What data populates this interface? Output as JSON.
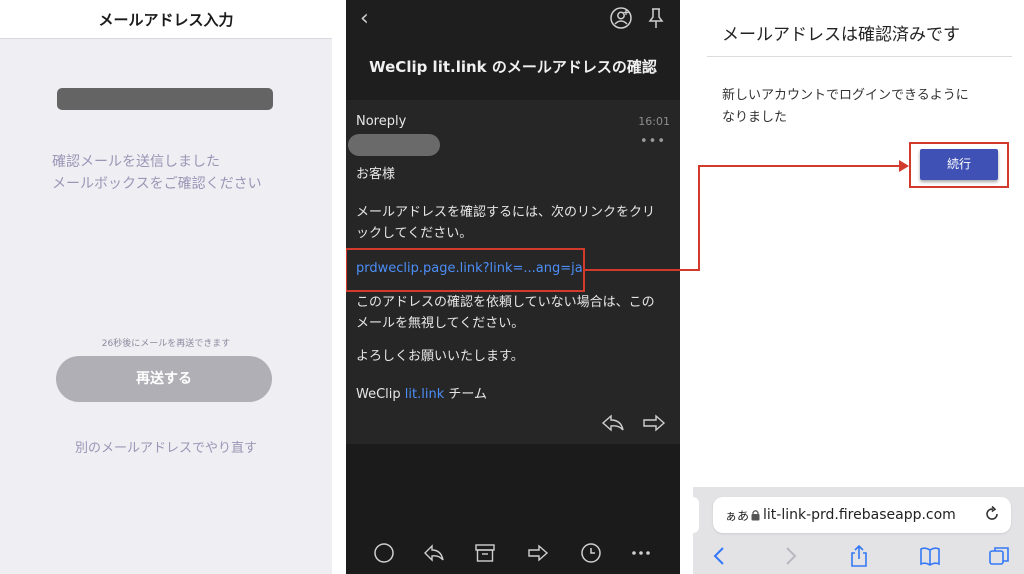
{
  "left": {
    "header_title": "メールアドレス入力",
    "sent_line1": "確認メールを送信しました",
    "sent_line2": "メールボックスをご確認ください",
    "countdown": "26秒後にメールを再送できます",
    "resend_label": "再送する",
    "retry_link": "別のメールアドレスでやり直す"
  },
  "middle": {
    "subject": "WeClip lit.link のメールアドレスの確認",
    "sender": "Noreply",
    "time": "16:01",
    "greeting": "お客様",
    "para1_line1": "メールアドレスを確認するには、次のリンクをクリ",
    "para1_line2": "ックしてください。",
    "link": "prdweclip.page.link?link=...ang=ja",
    "para2_line1": "このアドレスの確認を依頼していない場合は、この",
    "para2_line2": "メールを無視してください。",
    "closing": "よろしくお願いいたします。",
    "sig_prefix": "WeClip",
    "sig_link": "lit.link",
    "sig_suffix": "チーム",
    "more": "•••"
  },
  "right": {
    "title": "メールアドレスは確認済みです",
    "msg_line1": "新しいアカウントでログインできるように",
    "msg_line2": "なりました",
    "continue_label": "続行",
    "aa_label": "ぁあ",
    "url": "lit-link-prd.firebaseapp.com"
  },
  "colors": {
    "accent_red": "#d23a2c",
    "button_blue": "#3f51b5",
    "link_blue": "#4c8ef7",
    "purple_text": "#9b96b6"
  }
}
